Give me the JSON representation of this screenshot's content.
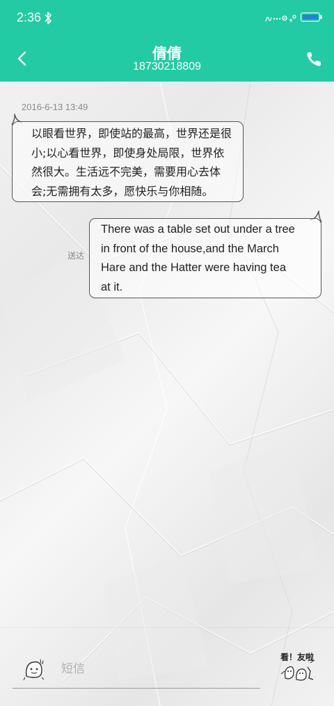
{
  "status_bar": {
    "time": "2:36",
    "icons": [
      "bluetooth-icon",
      "decorative-status-icons",
      "battery-icon"
    ],
    "battery_color": "#2a7fd9"
  },
  "header": {
    "background_color": "#22cba3",
    "contact_name": "倩倩",
    "contact_number": "18730218809",
    "back_icon": "chevron-left-icon",
    "call_icon": "phone-icon"
  },
  "conversation": {
    "timestamp": "2016-6-13 13:49",
    "messages": [
      {
        "direction": "incoming",
        "lines": [
          "以眼看世界，即使站的最高，世界还是很",
          "小;以心看世界，即使身处局限，世界依",
          "然很大。生活远不完美，需要用心去体",
          "会;无需拥有太多，愿快乐与你相随。"
        ]
      },
      {
        "direction": "outgoing",
        "status": "送达",
        "lines": [
          "There was a table set out under a tree",
          "in front of the house,and the March",
          "Hare and the Hatter were having tea",
          "at it."
        ]
      }
    ]
  },
  "composer": {
    "placeholder": "短信",
    "emoji_icon": "doodle-face-icon",
    "sticker_icon": "doodle-sticker-icon",
    "sticker_text": "看！友啦"
  }
}
